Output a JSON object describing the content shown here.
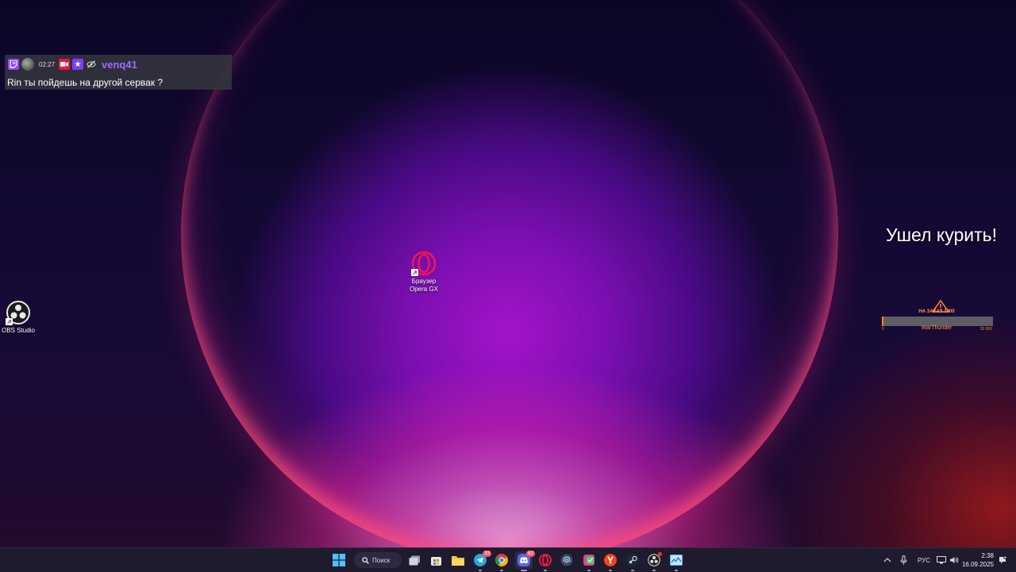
{
  "chat": {
    "time": "02:27",
    "username": "venq41",
    "message": "Rin ты пойдешь на другой сервак ?",
    "badges": [
      "twitch-icon",
      "avatar",
      "camera-badge-icon",
      "star-badge-icon",
      "eye-slash-icon"
    ],
    "colors": {
      "username": "#9f6bff",
      "background": "#34343e"
    }
  },
  "desktop": {
    "icons": [
      {
        "label1": "Браузер",
        "label2": "Opera GX",
        "icon": "opera-gx-icon"
      },
      {
        "label1": "OBS Studio",
        "icon": "obs-icon"
      }
    ]
  },
  "overlay": {
    "away_text": "Ушел курить!",
    "widget": {
      "top_text": "НА ЗАКАЗ 1000",
      "bottom_text": "WarThunder",
      "min": "0",
      "max": "20 000",
      "progress": 0.0
    }
  },
  "taskbar": {
    "search_label": "Поиск",
    "apps": [
      {
        "name": "windows-start",
        "icon": "windows-icon"
      },
      {
        "name": "search",
        "icon": "search-icon"
      },
      {
        "name": "task-view",
        "icon": "task-view-icon"
      },
      {
        "name": "store",
        "icon": "store-icon"
      },
      {
        "name": "file-explorer",
        "icon": "folder-icon"
      },
      {
        "name": "telegram",
        "icon": "telegram-icon",
        "badge": "33"
      },
      {
        "name": "chrome",
        "icon": "chrome-icon"
      },
      {
        "name": "discord",
        "icon": "discord-icon",
        "badge": "62"
      },
      {
        "name": "opera-gx",
        "icon": "opera-icon"
      },
      {
        "name": "fingerprint-app",
        "icon": "fingerprint-icon"
      },
      {
        "name": "green-app",
        "icon": "green-app-icon"
      },
      {
        "name": "yandex",
        "icon": "yandex-icon"
      },
      {
        "name": "steam",
        "icon": "steam-icon"
      },
      {
        "name": "obs",
        "icon": "obs-icon"
      },
      {
        "name": "task-manager",
        "icon": "monitor-icon"
      }
    ],
    "tray": {
      "language": "РУС",
      "time": "2:38",
      "date": "16.09.2025"
    }
  }
}
